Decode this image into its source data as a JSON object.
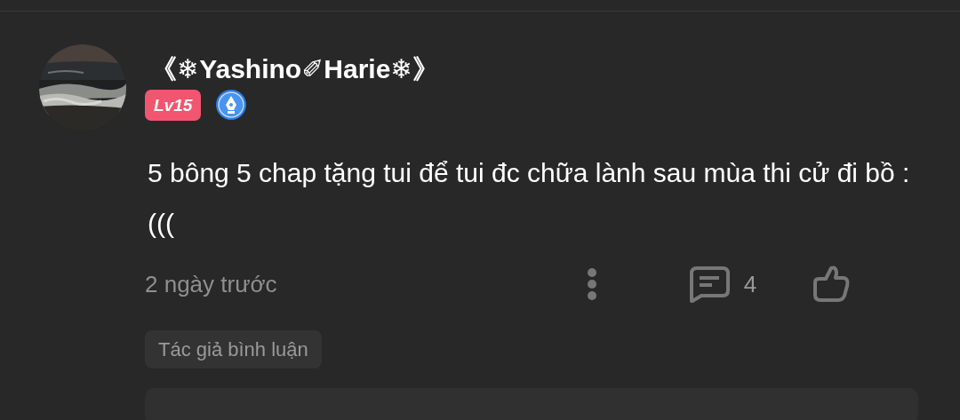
{
  "comment": {
    "author": "《❄Yashino✐Harie❄》",
    "level_badge": "Lv15",
    "text": "5 bông 5 chap tặng tui để tui đc chữa lành sau mùa thi cử đi bồ :(((",
    "time": "2 ngày trước",
    "reply_count": "4",
    "liked": false,
    "tag": "Tác giả bình luận"
  }
}
